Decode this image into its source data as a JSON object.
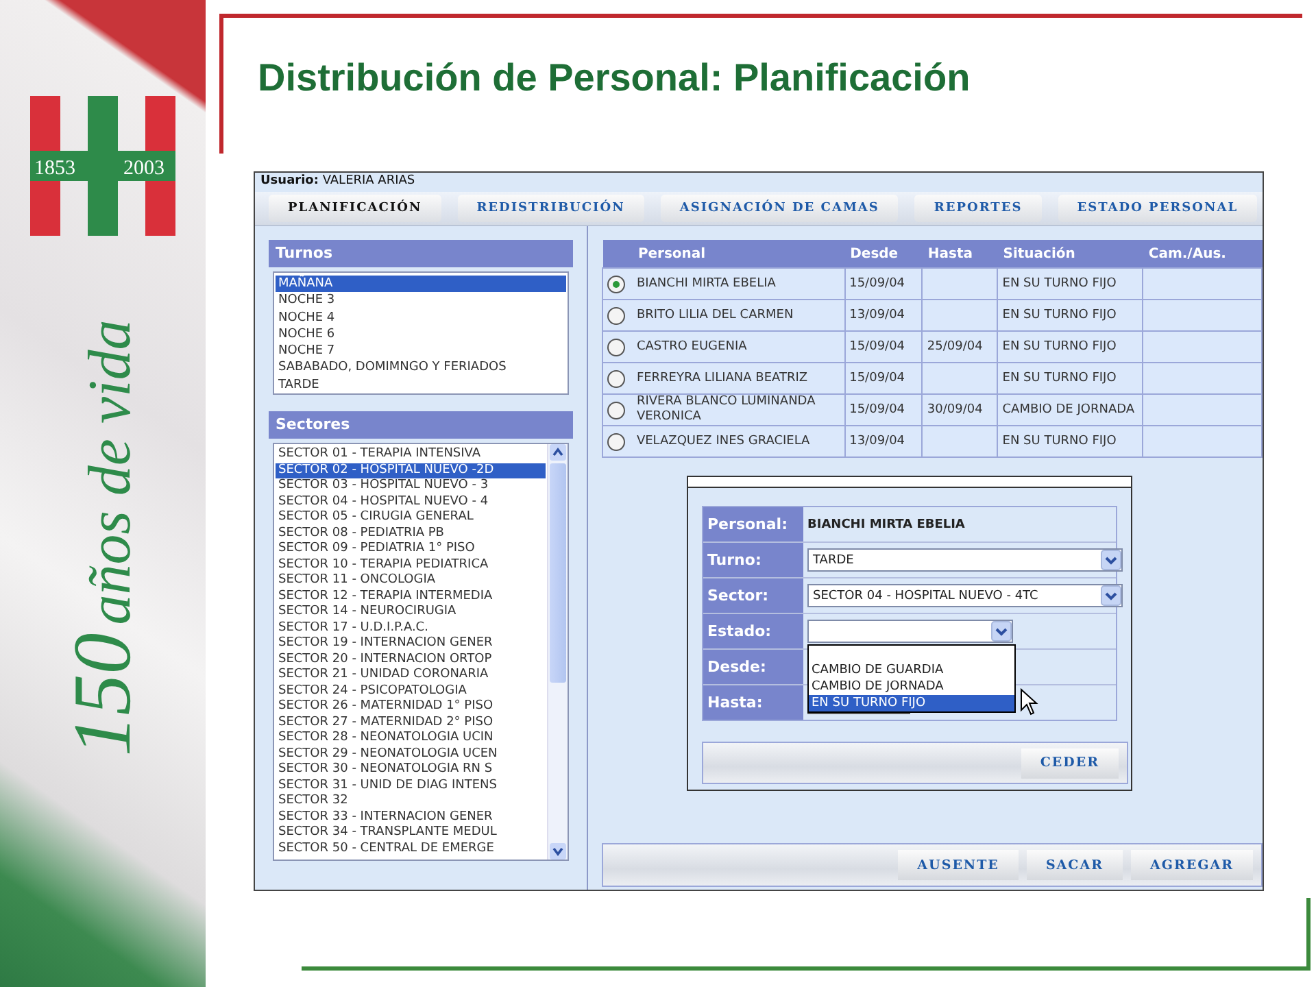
{
  "slide": {
    "title": "Distribución de Personal: Planificación"
  },
  "banner": {
    "logo_years": [
      "1853",
      "2003"
    ],
    "slogan_number": "150",
    "slogan_text": "años de vida"
  },
  "app": {
    "user": "**Usuario:** VALERIA ARIAS",
    "tabs": [
      {
        "label": "PLANIFICACIÓN",
        "selected": true
      },
      {
        "label": "REDISTRIBUCIÓN",
        "selected": false
      },
      {
        "label": "ASIGNACIÓN DE CAMAS",
        "selected": false
      },
      {
        "label": "REPORTES",
        "selected": false
      },
      {
        "label": "ESTADO PERSONAL",
        "selected": false
      }
    ],
    "turnos": {
      "title": "Turnos",
      "items": [
        {
          "label": "MAÑANA",
          "selected": true
        },
        {
          "label": "NOCHE 3",
          "selected": false
        },
        {
          "label": "NOCHE 4",
          "selected": false
        },
        {
          "label": "NOCHE 6",
          "selected": false
        },
        {
          "label": "NOCHE 7",
          "selected": false
        },
        {
          "label": "SABABADO, DOMIMNGO Y FERIADOS",
          "selected": false
        },
        {
          "label": "TARDE",
          "selected": false
        }
      ]
    },
    "sectores": {
      "title": "Sectores",
      "items": [
        {
          "label": "SECTOR 01 - TERAPIA INTENSIVA",
          "selected": false
        },
        {
          "label": "SECTOR 02 - HOSPITAL NUEVO -2D",
          "selected": true
        },
        {
          "label": "SECTOR 03 - HOSPITAL NUEVO - 3",
          "selected": false
        },
        {
          "label": "SECTOR 04 - HOSPITAL NUEVO - 4",
          "selected": false
        },
        {
          "label": "SECTOR 05 - CIRUGIA GENERAL",
          "selected": false
        },
        {
          "label": "SECTOR 08 - PEDIATRIA PB",
          "selected": false
        },
        {
          "label": "SECTOR 09 - PEDIATRIA 1° PISO",
          "selected": false
        },
        {
          "label": "SECTOR 10 - TERAPIA PEDIATRICA",
          "selected": false
        },
        {
          "label": "SECTOR 11 - ONCOLOGIA",
          "selected": false
        },
        {
          "label": "SECTOR 12 - TERAPIA INTERMEDIA",
          "selected": false
        },
        {
          "label": "SECTOR 14 - NEUROCIRUGIA",
          "selected": false
        },
        {
          "label": "SECTOR 17 - U.D.I.P.A.C.",
          "selected": false
        },
        {
          "label": "SECTOR 19 - INTERNACION GENER",
          "selected": false
        },
        {
          "label": "SECTOR 20 - INTERNACION ORTOP",
          "selected": false
        },
        {
          "label": "SECTOR 21 - UNIDAD CORONARIA",
          "selected": false
        },
        {
          "label": "SECTOR 24 - PSICOPATOLOGIA",
          "selected": false
        },
        {
          "label": "SECTOR 26 - MATERNIDAD 1° PISO",
          "selected": false
        },
        {
          "label": "SECTOR 27 - MATERNIDAD 2° PISO",
          "selected": false
        },
        {
          "label": "SECTOR 28 - NEONATOLOGIA UCIN",
          "selected": false
        },
        {
          "label": "SECTOR 29 - NEONATOLOGIA UCEN",
          "selected": false
        },
        {
          "label": "SECTOR 30 - NEONATOLOGIA RN S",
          "selected": false
        },
        {
          "label": "SECTOR 31 - UNID DE DIAG INTENS",
          "selected": false
        },
        {
          "label": "SECTOR 32",
          "selected": false
        },
        {
          "label": "SECTOR 33 - INTERNACION GENER",
          "selected": false
        },
        {
          "label": "SECTOR 34 - TRANSPLANTE MEDUL",
          "selected": false
        },
        {
          "label": "SECTOR 50 - CENTRAL DE EMERGE",
          "selected": false
        }
      ]
    },
    "personal_table": {
      "columns": [
        "Personal",
        "Desde",
        "Hasta",
        "Situación",
        "Cam./Aus."
      ],
      "rows": [
        {
          "selected": true,
          "cells": [
            "BIANCHI MIRTA EBELIA",
            "15/09/04",
            "",
            "EN SU TURNO FIJO",
            ""
          ]
        },
        {
          "selected": false,
          "cells": [
            "BRITO LILIA DEL CARMEN",
            "13/09/04",
            "",
            "EN SU TURNO FIJO",
            ""
          ]
        },
        {
          "selected": false,
          "cells": [
            "CASTRO EUGENIA",
            "15/09/04",
            "25/09/04",
            "EN SU TURNO FIJO",
            ""
          ]
        },
        {
          "selected": false,
          "cells": [
            "FERREYRA LILIANA BEATRIZ",
            "15/09/04",
            "",
            "EN SU TURNO FIJO",
            ""
          ]
        },
        {
          "selected": false,
          "cells": [
            "RIVERA BLANCO LUMINANDA VERONICA",
            "15/09/04",
            "30/09/04",
            "CAMBIO DE JORNADA",
            ""
          ]
        },
        {
          "selected": false,
          "cells": [
            "VELAZQUEZ INES GRACIELA",
            "13/09/04",
            "",
            "EN SU TURNO FIJO",
            ""
          ]
        }
      ]
    },
    "dialog": {
      "fields": [
        {
          "kind": "text",
          "label": "Personal:",
          "value": "BIANCHI MIRTA EBELIA"
        },
        {
          "kind": "select",
          "label": "Turno:",
          "value": "TARDE"
        },
        {
          "kind": "select",
          "label": "Sector:",
          "value": "SECTOR 04 - HOSPITAL NUEVO - 4TC"
        },
        {
          "kind": "open_select",
          "label": "Estado:",
          "options": [
            {
              "label": "CAMBIO DE GUARDIA",
              "selected": false
            },
            {
              "label": "CAMBIO DE JORNADA",
              "selected": false
            },
            {
              "label": "EN SU TURNO FIJO",
              "selected": true
            }
          ]
        },
        {
          "kind": "covered",
          "label": "Desde:"
        },
        {
          "kind": "date",
          "label": "Hasta:"
        }
      ],
      "button": "CEDER"
    },
    "buttons": [
      "AUSENTE",
      "SACAR",
      "AGREGAR"
    ]
  }
}
